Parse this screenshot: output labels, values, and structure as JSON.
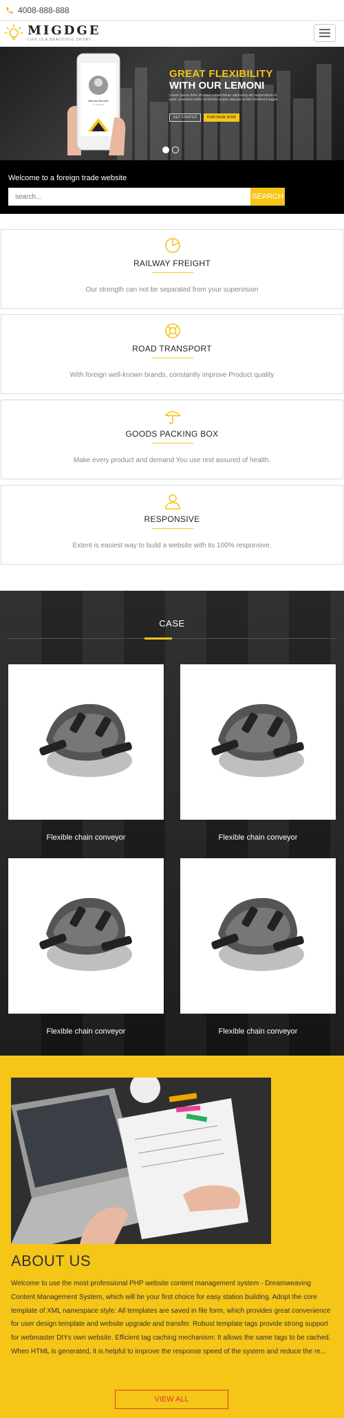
{
  "topbar": {
    "phone": "4008-888-888"
  },
  "header": {
    "logo_name": "MIGDGE",
    "logo_tagline": "LIFE IS A BEAUTIFUL SPORT"
  },
  "hero": {
    "title_line1": "GREAT FLEXIBILITY",
    "title_line2": "WITH OUR LEMONI",
    "description": "Lorem ipsum dolor sit amet consectetuer adipiscing elit suspendisse et justo, praesent mattis commodo augue aliquam ornare hendrerit augue.",
    "button_primary": "GET STARTED",
    "button_secondary": "PURCHASE NOW!",
    "phone_name": "Michael Michelle",
    "phone_role": "Sr. Designer"
  },
  "search": {
    "welcome": "Welcome to a foreign trade website",
    "placeholder": "search...",
    "button": "SEARCH"
  },
  "services": [
    {
      "title": "RAILWAY FREIGHT",
      "desc": "Our strength can not be separated from your supervision"
    },
    {
      "title": "ROAD TRANSPORT",
      "desc": "With foreign well-known brands, constantly improve Product quality"
    },
    {
      "title": "GOODS PACKING BOX",
      "desc": "Make every product and demand You use rest assured of health."
    },
    {
      "title": "RESPONSIVE",
      "desc": "Extent is easiest way to build a website with its 100% responsive."
    }
  ],
  "case": {
    "title": "CASE",
    "items": [
      {
        "label": "Flexible chain conveyor"
      },
      {
        "label": "Flexible chain conveyor"
      },
      {
        "label": "Flexible chain conveyor"
      },
      {
        "label": "Flexible chain conveyor"
      }
    ]
  },
  "about": {
    "title": "ABOUT US",
    "text": "Welcome to use the most professional PHP website content management system - Dreamweaving Content Management System, which will be your first choice for easy station building. Adopt the core template of XML namespace style: All templates are saved in file form, which provides great convenience for user design template and website upgrade and transfer. Robust template tags provide strong support for webmaster DIYs own website. Efficient tag caching mechanism: It allows the same tags to be cached. When HTML is generated, it is helpful to improve the response speed of the system and reduce the re...",
    "button": "VIEW ALL"
  },
  "colors": {
    "accent": "#f5c518",
    "dark": "#000000",
    "view_all": "#e03a2f"
  },
  "icons": {
    "phone": "phone-icon",
    "logo": "lightbulb-icon",
    "menu": "hamburger-menu-icon",
    "services": [
      "pie-chart-icon",
      "lifebuoy-icon",
      "umbrella-icon",
      "user-icon"
    ]
  }
}
